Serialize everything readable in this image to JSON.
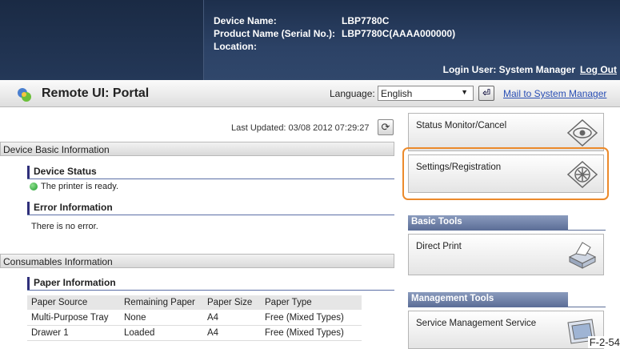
{
  "header": {
    "device_name_label": "Device Name:",
    "device_name_value": "LBP7780C",
    "product_name_label": "Product Name (Serial No.):",
    "product_name_value": "LBP7780C(AAAA000000)",
    "location_label": "Location:",
    "login_user": "Login User: System Manager",
    "logout": "Log Out"
  },
  "portal": {
    "title": "Remote UI: Portal",
    "language_label": "Language:",
    "language_value": "English",
    "mail_link": "Mail to System Manager"
  },
  "status": {
    "last_updated": "Last Updated: 03/08 2012 07:29:27"
  },
  "device_basic": {
    "header": "Device Basic Information",
    "device_status_title": "Device Status",
    "device_status_text": "The printer is ready.",
    "error_title": "Error Information",
    "error_text": "There is no error."
  },
  "consumables": {
    "header": "Consumables Information",
    "paper_title": "Paper Information",
    "columns": [
      "Paper Source",
      "Remaining Paper",
      "Paper Size",
      "Paper Type"
    ],
    "rows": [
      [
        "Multi-Purpose Tray",
        "None",
        "A4",
        "Free (Mixed Types)"
      ],
      [
        "Drawer 1",
        "Loaded",
        "A4",
        "Free (Mixed Types)"
      ]
    ]
  },
  "right_panel": {
    "status_monitor": "Status Monitor/Cancel",
    "settings": "Settings/Registration",
    "basic_tools": "Basic Tools",
    "direct_print": "Direct Print",
    "management_tools": "Management Tools",
    "service_management": "Service Management Service"
  },
  "figure_label": "F-2-54",
  "colors": {
    "header_bg": "#2c4266",
    "highlight": "#ec8a2b",
    "link": "#2a4fb5",
    "tool_header": "#5d6f98"
  }
}
